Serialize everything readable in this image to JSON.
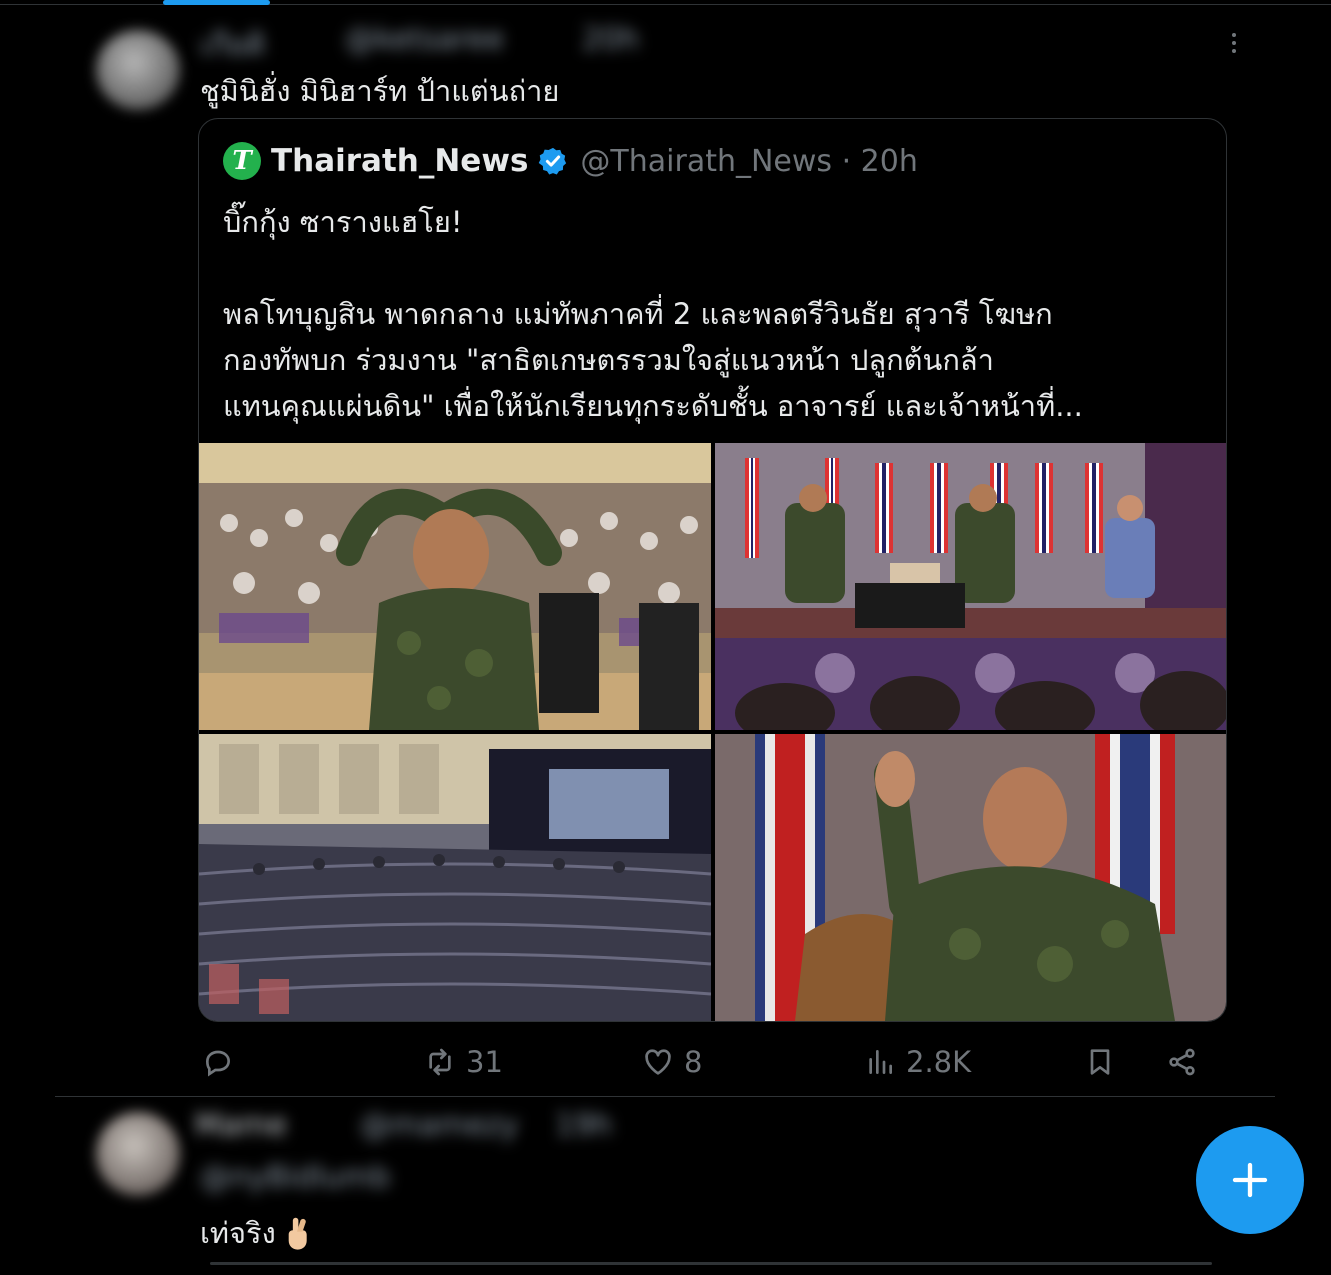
{
  "colors": {
    "accent": "#1d9bf0",
    "verified": "#1d9bf0",
    "logo_green": "#23b14d",
    "muted": "#71767b",
    "text": "#e7e9ea",
    "background": "#000000"
  },
  "post": {
    "author_name": "เกียติ",
    "author_handle": "@ketsaree",
    "time": "20h",
    "text": "ชูมินิฮั่ง มินิฮาร์ท ป้าแต่นถ่าย",
    "quote": {
      "name": "Thairath_News",
      "logo_letter": "T",
      "handle_time": "@Thairath_News · 20h",
      "lines": [
        "บิ๊กกุ้ง ซารางแฮโย!",
        "",
        "พลโทบุญสิน พาดกลาง แม่ทัพภาคที่ 2 และพลตรีวินธัย สุวารี โฆษก",
        "กองทัพบก ร่วมงาน \"สาธิตเกษตรรวมใจสู่แนวหน้า ปลูกต้นกล้า",
        "แทนคุณแผ่นดิน\" เพื่อให้นักเรียนทุกระดับชั้น อาจารย์ และเจ้าหน้าที่..."
      ],
      "media": [
        {
          "icon": "photo-heart-gesture"
        },
        {
          "icon": "photo-stage-panel"
        },
        {
          "icon": "photo-auditorium"
        },
        {
          "icon": "photo-mini-heart"
        }
      ]
    },
    "actions": {
      "reply": {
        "icon": "reply-icon",
        "count": ""
      },
      "retweet": {
        "icon": "retweet-icon",
        "count": "31"
      },
      "like": {
        "icon": "heart-icon",
        "count": "8"
      },
      "views": {
        "icon": "views-icon",
        "count": "2.8K"
      },
      "bookmark": {
        "icon": "bookmark-icon"
      },
      "share": {
        "icon": "share-icon"
      }
    }
  },
  "reply": {
    "author_name": "Mame",
    "author_handle": "@mamezy",
    "reply_to": "@nyBidlumb",
    "time": "19h",
    "text": "เท่จริง"
  },
  "fab": {
    "icon": "plus-icon"
  }
}
